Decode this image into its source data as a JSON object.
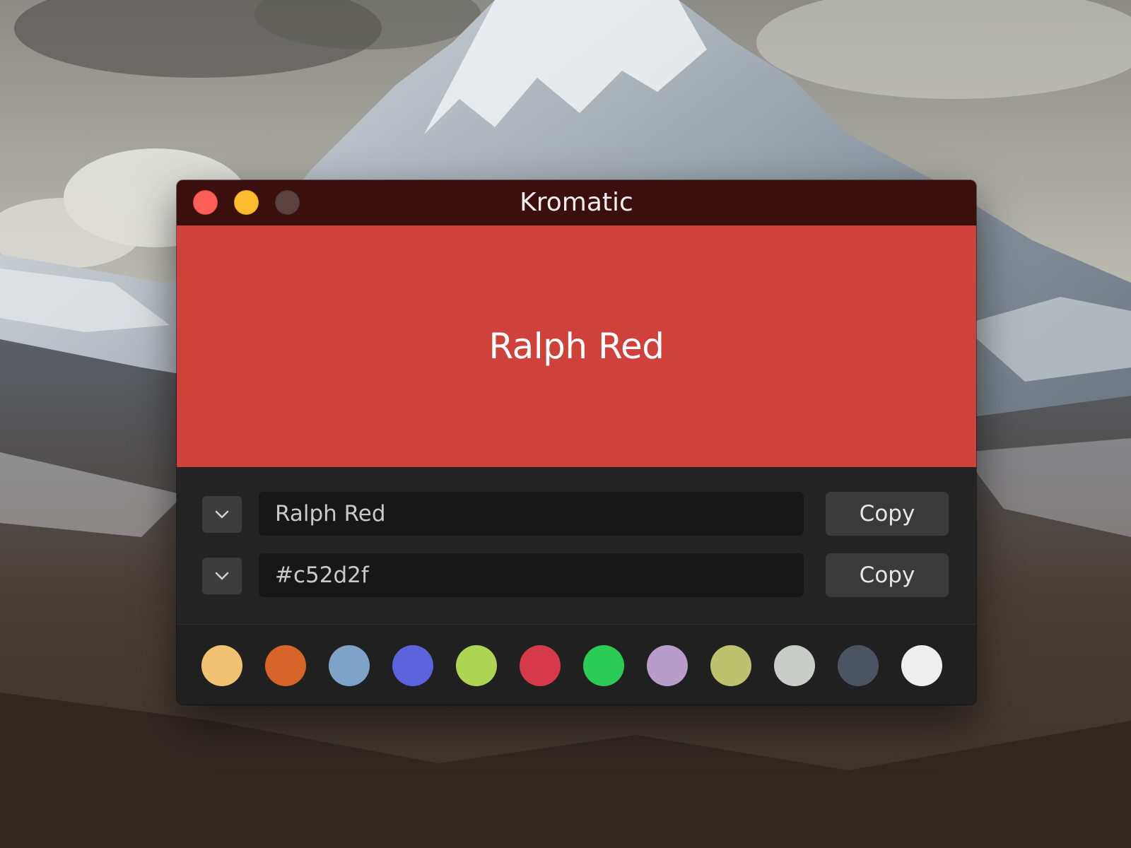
{
  "window": {
    "title": "Kromatic"
  },
  "preview": {
    "color_name": "Ralph Red",
    "fill": "#cf423b"
  },
  "fields": [
    {
      "value": "Ralph Red",
      "button_label": "Copy"
    },
    {
      "value": "#c52d2f",
      "button_label": "Copy"
    }
  ],
  "palette": [
    "#f0c271",
    "#d7652a",
    "#7fa3c6",
    "#5b63dd",
    "#aed454",
    "#d6394a",
    "#2bcc56",
    "#b89cc9",
    "#bcc26d",
    "#c9ccc7",
    "#4d5461",
    "#eeeeee"
  ],
  "icons": {
    "dropdown": "chevron-down-icon",
    "close": "close-button",
    "minimize": "minimize-button",
    "zoom": "zoom-button"
  }
}
